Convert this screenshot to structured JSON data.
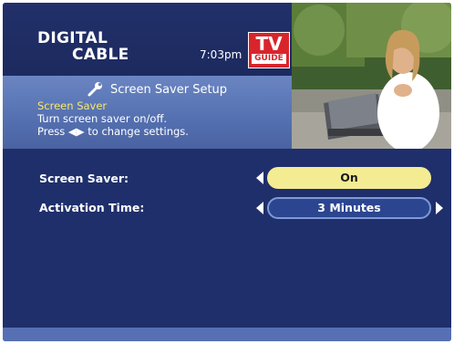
{
  "header": {
    "logo_line1": "DIGITAL",
    "logo_line2": "CABLE",
    "time": "7:03pm",
    "tvguide_tv": "TV",
    "tvguide_guide": "GUIDE"
  },
  "info": {
    "title": "Screen Saver Setup",
    "subtitle": "Screen Saver",
    "line1": "Turn screen saver on/off.",
    "line2": "Press ◀▶ to change settings."
  },
  "settings": [
    {
      "label": "Screen Saver:",
      "value": "On",
      "selected": true
    },
    {
      "label": "Activation Time:",
      "value": "3 Minutes",
      "selected": false
    }
  ],
  "colors": {
    "background": "#1f2f6b",
    "info_panel": "#5470b0",
    "highlight_text": "#f6e86a",
    "selected_pill": "#f4ec93",
    "tvguide_red": "#d8252c"
  }
}
